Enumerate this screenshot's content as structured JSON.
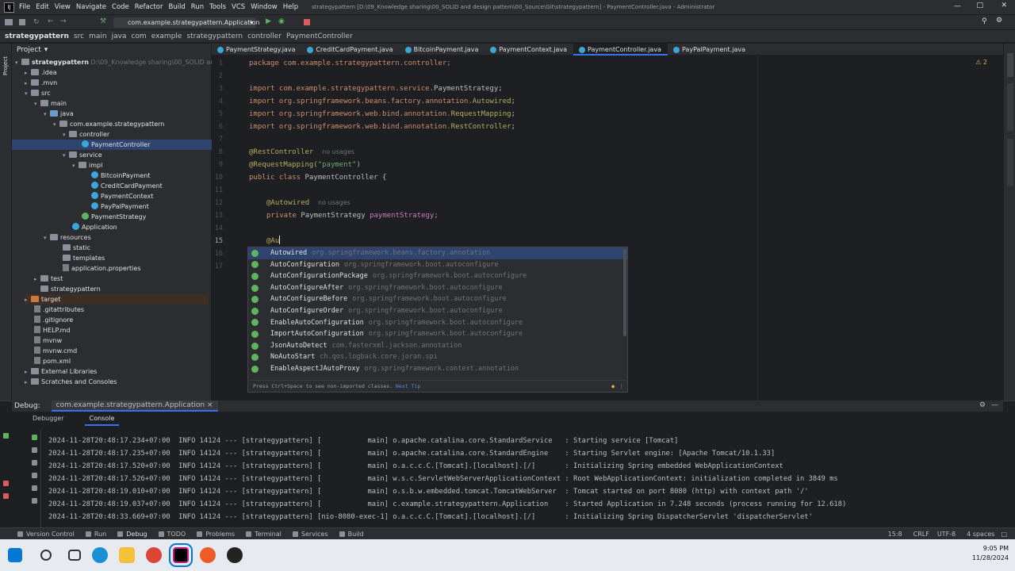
{
  "window": {
    "title": "strategypattern [D:\\09_Knowledge sharing\\00_SOLID and design pattern\\00_Source\\Git\\strategypattern] - PaymentController.java - Administrator",
    "menu": [
      "File",
      "Edit",
      "View",
      "Navigate",
      "Code",
      "Refactor",
      "Build",
      "Run",
      "Tools",
      "VCS",
      "Window",
      "Help"
    ],
    "run_config": "com.example.strategypattern.Application"
  },
  "breadcrumb": [
    "strategypattern",
    "src",
    "main",
    "java",
    "com",
    "example",
    "strategypattern",
    "controller",
    "PaymentController"
  ],
  "project": {
    "header": "Project",
    "root": "strategypattern",
    "root_path": "D:\\09_Knowledge sharing\\00_SOLID and desi",
    "items": [
      ".idea",
      ".mvn",
      "src",
      "main",
      "java",
      "com.example.strategypattern",
      "controller",
      "PaymentController",
      "service",
      "impl",
      "BitcoinPayment",
      "CreditCardPayment",
      "PaymentContext",
      "PayPalPayment",
      "PaymentStrategy",
      "Application",
      "resources",
      "static",
      "templates",
      "application.properties",
      "test",
      "strategypattern",
      "target",
      ".gitattributes",
      ".gitignore",
      "HELP.md",
      "mvnw",
      "mvnw.cmd",
      "pom.xml",
      "External Libraries",
      "Scratches and Consoles"
    ]
  },
  "tabs": [
    "PaymentStrategy.java",
    "CreditCardPayment.java",
    "BitcoinPayment.java",
    "PaymentContext.java",
    "PaymentController.java",
    "PayPalPayment.java"
  ],
  "editor": {
    "warnings": "2",
    "line_numbers": [
      "1",
      "2",
      "3",
      "4",
      "5",
      "6",
      "7",
      "8",
      "9",
      "10",
      "11",
      "12",
      "13",
      "14",
      "15",
      "16",
      "17"
    ],
    "package_line": "package com.example.strategypattern.controller;",
    "imports": [
      {
        "prefix": "import com.example.strategypattern.service.",
        "cls": "PaymentStrategy",
        ";": ";"
      },
      {
        "prefix": "import org.springframework.beans.factory.annotation.",
        "cls": "Autowired"
      },
      {
        "prefix": "import org.springframework.web.bind.annotation.",
        "cls": "RequestMapping"
      },
      {
        "prefix": "import org.springframework.web.bind.annotation.",
        "cls": "RestController"
      }
    ],
    "annotation1": "@RestController",
    "usage1": "no usages",
    "annotation2": "@RequestMapping(",
    "annotation2_str": "\"payment\"",
    "class_kw": "public class",
    "class_name": "PaymentController {",
    "autowired": "@Autowired",
    "usage2": "no usages",
    "field_kw": "private",
    "field_type": "PaymentStrategy",
    "field_name": "paymentStrategy;",
    "typing": "@Au",
    "completions": [
      {
        "name": "Autowired",
        "pkg": "org.springframework.beans.factory.annotation"
      },
      {
        "name": "AutoConfiguration",
        "pkg": "org.springframework.boot.autoconfigure"
      },
      {
        "name": "AutoConfigurationPackage",
        "pkg": "org.springframework.boot.autoconfigure"
      },
      {
        "name": "AutoConfigureAfter",
        "pkg": "org.springframework.boot.autoconfigure"
      },
      {
        "name": "AutoConfigureBefore",
        "pkg": "org.springframework.boot.autoconfigure"
      },
      {
        "name": "AutoConfigureOrder",
        "pkg": "org.springframework.boot.autoconfigure"
      },
      {
        "name": "EnableAutoConfiguration",
        "pkg": "org.springframework.boot.autoconfigure"
      },
      {
        "name": "ImportAutoConfiguration",
        "pkg": "org.springframework.boot.autoconfigure"
      },
      {
        "name": "JsonAutoDetect",
        "pkg": "com.fasterxml.jackson.annotation"
      },
      {
        "name": "NoAutoStart",
        "pkg": "ch.qos.logback.core.joran.spi"
      },
      {
        "name": "EnableAspectJAutoProxy",
        "pkg": "org.springframework.context.annotation"
      }
    ],
    "popup_footer": "Press Ctrl+Space to see non-imported classes.",
    "popup_tip": "Next Tip"
  },
  "debug": {
    "label": "Debug:",
    "session": "com.example.strategypattern.Application",
    "tabs": [
      "Debugger",
      "Console"
    ],
    "log": [
      "2024-11-28T20:48:17.234+07:00  INFO 14124 --- [strategypattern] [           main] o.apache.catalina.core.StandardService   : Starting service [Tomcat]",
      "2024-11-28T20:48:17.235+07:00  INFO 14124 --- [strategypattern] [           main] o.apache.catalina.core.StandardEngine    : Starting Servlet engine: [Apache Tomcat/10.1.33]",
      "2024-11-28T20:48:17.520+07:00  INFO 14124 --- [strategypattern] [           main] o.a.c.c.C.[Tomcat].[localhost].[/]       : Initializing Spring embedded WebApplicationContext",
      "2024-11-28T20:48:17.526+07:00  INFO 14124 --- [strategypattern] [           main] w.s.c.ServletWebServerApplicationContext : Root WebApplicationContext: initialization completed in 3849 ms",
      "2024-11-28T20:48:19.010+07:00  INFO 14124 --- [strategypattern] [           main] o.s.b.w.embedded.tomcat.TomcatWebServer  : Tomcat started on port 8080 (http) with context path '/'",
      "2024-11-28T20:48:19.037+07:00  INFO 14124 --- [strategypattern] [           main] c.example.strategypattern.Application    : Started Application in 7.248 seconds (process running for 12.618)",
      "2024-11-28T20:48:33.669+07:00  INFO 14124 --- [strategypattern] [nio-8080-exec-1] o.a.c.c.C.[Tomcat].[localhost].[/]       : Initializing Spring DispatcherServlet 'dispatcherServlet'"
    ]
  },
  "statusbar": {
    "items": [
      "Version Control",
      "Run",
      "Debug",
      "TODO",
      "Problems",
      "Terminal",
      "Services",
      "Build"
    ],
    "position": "15:8",
    "line_sep": "CRLF",
    "encoding": "UTF-8",
    "indent": "4 spaces"
  },
  "taskbar": {
    "time": "9:05 PM",
    "date": "11/28/2024"
  },
  "colors": {
    "accent": "#3574f0",
    "selection": "#2e436e",
    "keyword": "#cf8e6d",
    "annotation": "#b3ae60",
    "string": "#6aab73"
  }
}
